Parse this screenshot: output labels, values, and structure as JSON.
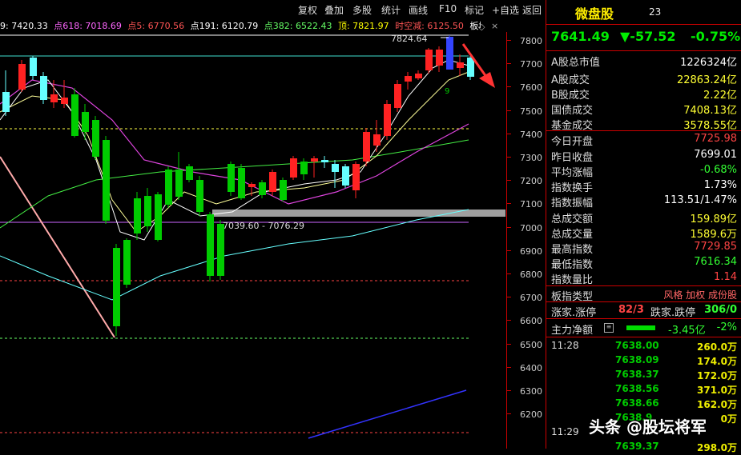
{
  "toolbar": {
    "buttons": [
      "复权",
      "叠加",
      "多股",
      "统计",
      "画线",
      "F10",
      "标记",
      "+自选",
      "返回"
    ]
  },
  "indicator_line": [
    {
      "text": "9: 7420.33",
      "color": "#ffffff"
    },
    {
      "text": "点618: 7018.69",
      "color": "#ff66ff"
    },
    {
      "text": "点5: 6770.56",
      "color": "#ff5555"
    },
    {
      "text": "点191: 6120.79",
      "color": "#ffffff"
    },
    {
      "text": "点382: 6522.43",
      "color": "#66ff66"
    },
    {
      "text": "顶: 7821.97",
      "color": "#ffff00"
    },
    {
      "text": "时空减: 6125.50",
      "color": "#ff5555"
    },
    {
      "text": "板块:",
      "color": "#ffffff"
    }
  ],
  "chart_labels": {
    "high_mark": "7824.64",
    "gap_range": "7039.60 - 7076.29",
    "nine": "9"
  },
  "price_axis": [
    "7800",
    "7700",
    "7600",
    "7500",
    "7400",
    "7300",
    "7200",
    "7100",
    "7000",
    "6900",
    "6800",
    "6700",
    "6600",
    "6500",
    "6400",
    "6300",
    "6200"
  ],
  "panel": {
    "title": "微盘股",
    "code": "23",
    "price": "7641.49",
    "change": "▼-57.52",
    "change_pct": "-0.75%",
    "rows": [
      {
        "label": "A股总市值",
        "value": "1226324亿",
        "color": "#ffffff"
      },
      {
        "label": "A股成交",
        "value": "22863.24亿",
        "color": "#ffff33"
      },
      {
        "label": "B股成交",
        "value": "2.22亿",
        "color": "#ffff33"
      },
      {
        "label": "国债成交",
        "value": "7408.13亿",
        "color": "#ffff33"
      },
      {
        "label": "基金成交",
        "value": "3578.55亿",
        "color": "#ffff33"
      },
      {
        "label": "今日开盘",
        "value": "7725.98",
        "color": "#ff4444"
      },
      {
        "label": "昨日收盘",
        "value": "7699.01",
        "color": "#ffffff"
      },
      {
        "label": "平均涨幅",
        "value": "-0.68%",
        "color": "#33ff33"
      },
      {
        "label": "指数换手",
        "value": "1.73%",
        "color": "#ffffff"
      },
      {
        "label": "指数振幅",
        "value": "113.51/1.47%",
        "color": "#ffffff"
      },
      {
        "label": "总成交额",
        "value": "159.89亿",
        "color": "#ffff33"
      },
      {
        "label": "总成交量",
        "value": "1589.6万",
        "color": "#ffff33"
      },
      {
        "label": "最高指数",
        "value": "7729.85",
        "color": "#ff4444"
      },
      {
        "label": "最低指数",
        "value": "7616.34",
        "color": "#33ff33"
      },
      {
        "label": "指数量比",
        "value": "1.14",
        "color": "#ff4444"
      }
    ],
    "board_type_label": "板指类型",
    "board_type_tags": "风格 加权 成份股",
    "updown_label": "涨家.涨停",
    "updown_value": "82/3",
    "down_label": "跌家.跌停",
    "down_value": "306/0",
    "net_label": "主力净额",
    "net_value": "-3.45亿",
    "net_pct": "-2%",
    "ticks": [
      {
        "time": "11:28",
        "price": "7638.00",
        "vol": "260.0万"
      },
      {
        "time": "",
        "price": "7638.09",
        "vol": "174.0万"
      },
      {
        "time": "",
        "price": "7638.37",
        "vol": "172.0万"
      },
      {
        "time": "",
        "price": "7638.56",
        "vol": "371.0万"
      },
      {
        "time": "",
        "price": "7638.66",
        "vol": "162.0万"
      },
      {
        "time": "",
        "price": "7638.9",
        "vol": "0万"
      },
      {
        "time": "11:29",
        "price": "",
        "vol": ""
      },
      {
        "time": "",
        "price": "7639.37",
        "vol": "298.0万"
      }
    ]
  },
  "watermark": "头条 @股坛将军",
  "colors": {
    "up": "#ff2222",
    "down": "#00cc00",
    "axis": "#cc0000"
  }
}
